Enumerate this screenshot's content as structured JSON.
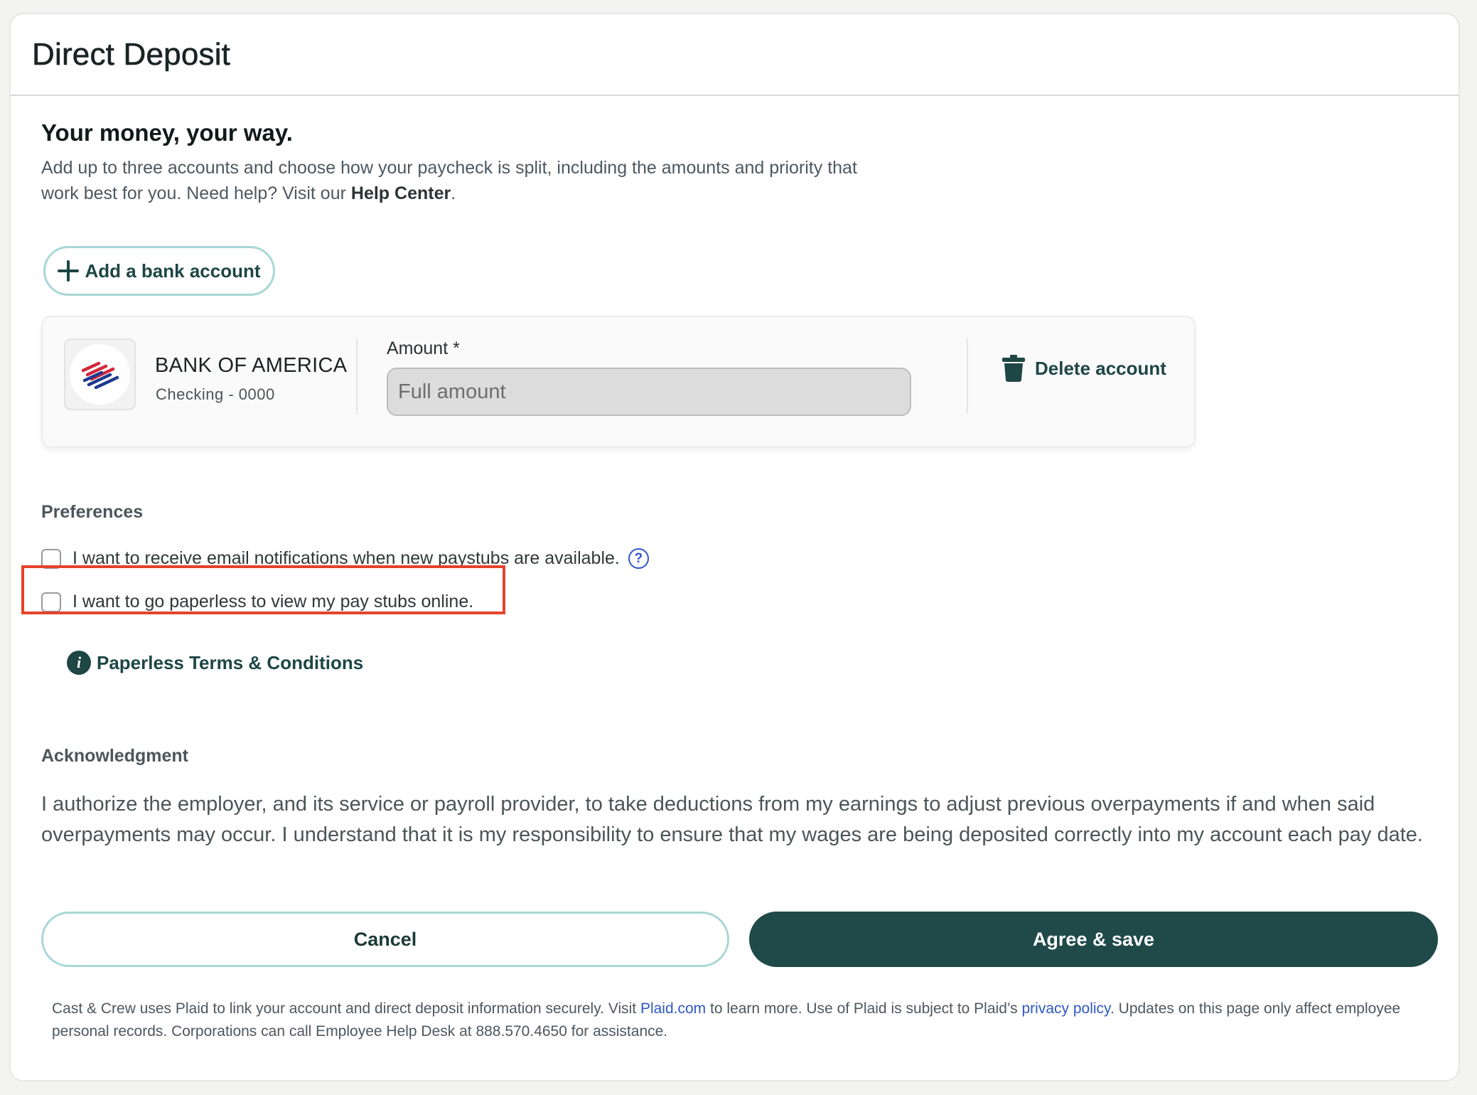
{
  "page": {
    "title": "Direct Deposit"
  },
  "intro": {
    "headline": "Your money, your way.",
    "text": "Add up to three accounts and choose how your paycheck is split, including the amounts and priority that work best for you. Need help? Visit our",
    "help_link": "Help Center",
    "text_end": "."
  },
  "add_account": {
    "label": "Add a bank account",
    "icon": "plus-icon"
  },
  "account": {
    "bank_name": "BANK OF AMERICA",
    "account_type": "Checking - 0000",
    "amount_label": "Amount *",
    "amount_placeholder": "Full amount",
    "delete_label": "Delete account",
    "delete_icon": "trash-icon"
  },
  "preferences": {
    "title": "Preferences",
    "email_notifications": {
      "label": "I want to receive email notifications when new paystubs are available.",
      "checked": false
    },
    "paperless": {
      "label": "I want to go paperless to view my pay stubs online.",
      "checked": false
    },
    "help_icon": "?",
    "terms_label": "Paperless Terms & Conditions",
    "terms_icon": "i"
  },
  "acknowledgment": {
    "title": "Acknowledgment",
    "text": "I authorize the employer, and its service or payroll provider, to take deductions from my earnings to adjust previous overpayments if and when said overpayments may occur. I understand that it is my responsibility to ensure that my wages are being deposited correctly into my account each pay date."
  },
  "actions": {
    "cancel": "Cancel",
    "save": "Agree & save"
  },
  "footer": {
    "part1": "Cast & Crew uses Plaid to link your account and direct deposit information securely. Visit",
    "plaid_link": "Plaid.com",
    "part2": "to learn more. Use of Plaid is subject to Plaid’s",
    "privacy_link": "privacy policy",
    "part3": ". Updates on this page only affect employee personal records. Corporations can call Employee Help Desk at 888.570.4650 for assistance."
  },
  "colors": {
    "primary": "#1f4a49",
    "outline": "#a9d6d6",
    "link_blue": "#2d57c5",
    "highlight_red": "#e4432b"
  }
}
